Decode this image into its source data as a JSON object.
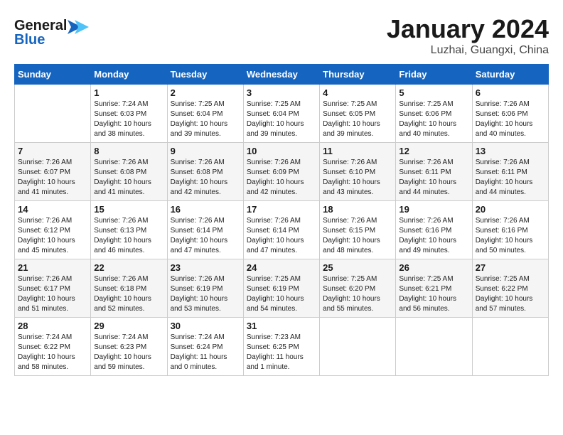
{
  "logo": {
    "line1": "General",
    "line2": "Blue"
  },
  "title": "January 2024",
  "subtitle": "Luzhai, Guangxi, China",
  "days_of_week": [
    "Sunday",
    "Monday",
    "Tuesday",
    "Wednesday",
    "Thursday",
    "Friday",
    "Saturday"
  ],
  "weeks": [
    [
      {
        "day": "",
        "info": ""
      },
      {
        "day": "1",
        "info": "Sunrise: 7:24 AM\nSunset: 6:03 PM\nDaylight: 10 hours\nand 38 minutes."
      },
      {
        "day": "2",
        "info": "Sunrise: 7:25 AM\nSunset: 6:04 PM\nDaylight: 10 hours\nand 39 minutes."
      },
      {
        "day": "3",
        "info": "Sunrise: 7:25 AM\nSunset: 6:04 PM\nDaylight: 10 hours\nand 39 minutes."
      },
      {
        "day": "4",
        "info": "Sunrise: 7:25 AM\nSunset: 6:05 PM\nDaylight: 10 hours\nand 39 minutes."
      },
      {
        "day": "5",
        "info": "Sunrise: 7:25 AM\nSunset: 6:06 PM\nDaylight: 10 hours\nand 40 minutes."
      },
      {
        "day": "6",
        "info": "Sunrise: 7:26 AM\nSunset: 6:06 PM\nDaylight: 10 hours\nand 40 minutes."
      }
    ],
    [
      {
        "day": "7",
        "info": "Sunrise: 7:26 AM\nSunset: 6:07 PM\nDaylight: 10 hours\nand 41 minutes."
      },
      {
        "day": "8",
        "info": "Sunrise: 7:26 AM\nSunset: 6:08 PM\nDaylight: 10 hours\nand 41 minutes."
      },
      {
        "day": "9",
        "info": "Sunrise: 7:26 AM\nSunset: 6:08 PM\nDaylight: 10 hours\nand 42 minutes."
      },
      {
        "day": "10",
        "info": "Sunrise: 7:26 AM\nSunset: 6:09 PM\nDaylight: 10 hours\nand 42 minutes."
      },
      {
        "day": "11",
        "info": "Sunrise: 7:26 AM\nSunset: 6:10 PM\nDaylight: 10 hours\nand 43 minutes."
      },
      {
        "day": "12",
        "info": "Sunrise: 7:26 AM\nSunset: 6:11 PM\nDaylight: 10 hours\nand 44 minutes."
      },
      {
        "day": "13",
        "info": "Sunrise: 7:26 AM\nSunset: 6:11 PM\nDaylight: 10 hours\nand 44 minutes."
      }
    ],
    [
      {
        "day": "14",
        "info": "Sunrise: 7:26 AM\nSunset: 6:12 PM\nDaylight: 10 hours\nand 45 minutes."
      },
      {
        "day": "15",
        "info": "Sunrise: 7:26 AM\nSunset: 6:13 PM\nDaylight: 10 hours\nand 46 minutes."
      },
      {
        "day": "16",
        "info": "Sunrise: 7:26 AM\nSunset: 6:14 PM\nDaylight: 10 hours\nand 47 minutes."
      },
      {
        "day": "17",
        "info": "Sunrise: 7:26 AM\nSunset: 6:14 PM\nDaylight: 10 hours\nand 47 minutes."
      },
      {
        "day": "18",
        "info": "Sunrise: 7:26 AM\nSunset: 6:15 PM\nDaylight: 10 hours\nand 48 minutes."
      },
      {
        "day": "19",
        "info": "Sunrise: 7:26 AM\nSunset: 6:16 PM\nDaylight: 10 hours\nand 49 minutes."
      },
      {
        "day": "20",
        "info": "Sunrise: 7:26 AM\nSunset: 6:16 PM\nDaylight: 10 hours\nand 50 minutes."
      }
    ],
    [
      {
        "day": "21",
        "info": "Sunrise: 7:26 AM\nSunset: 6:17 PM\nDaylight: 10 hours\nand 51 minutes."
      },
      {
        "day": "22",
        "info": "Sunrise: 7:26 AM\nSunset: 6:18 PM\nDaylight: 10 hours\nand 52 minutes."
      },
      {
        "day": "23",
        "info": "Sunrise: 7:26 AM\nSunset: 6:19 PM\nDaylight: 10 hours\nand 53 minutes."
      },
      {
        "day": "24",
        "info": "Sunrise: 7:25 AM\nSunset: 6:19 PM\nDaylight: 10 hours\nand 54 minutes."
      },
      {
        "day": "25",
        "info": "Sunrise: 7:25 AM\nSunset: 6:20 PM\nDaylight: 10 hours\nand 55 minutes."
      },
      {
        "day": "26",
        "info": "Sunrise: 7:25 AM\nSunset: 6:21 PM\nDaylight: 10 hours\nand 56 minutes."
      },
      {
        "day": "27",
        "info": "Sunrise: 7:25 AM\nSunset: 6:22 PM\nDaylight: 10 hours\nand 57 minutes."
      }
    ],
    [
      {
        "day": "28",
        "info": "Sunrise: 7:24 AM\nSunset: 6:22 PM\nDaylight: 10 hours\nand 58 minutes."
      },
      {
        "day": "29",
        "info": "Sunrise: 7:24 AM\nSunset: 6:23 PM\nDaylight: 10 hours\nand 59 minutes."
      },
      {
        "day": "30",
        "info": "Sunrise: 7:24 AM\nSunset: 6:24 PM\nDaylight: 11 hours\nand 0 minutes."
      },
      {
        "day": "31",
        "info": "Sunrise: 7:23 AM\nSunset: 6:25 PM\nDaylight: 11 hours\nand 1 minute."
      },
      {
        "day": "",
        "info": ""
      },
      {
        "day": "",
        "info": ""
      },
      {
        "day": "",
        "info": ""
      }
    ]
  ]
}
